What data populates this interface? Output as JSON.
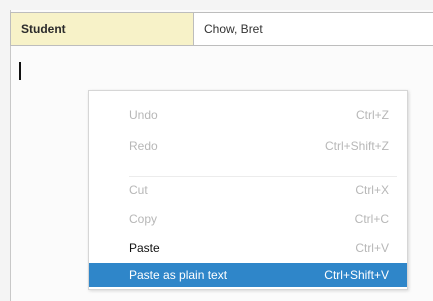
{
  "header": {
    "label": "Student",
    "value": "Chow, Bret"
  },
  "context_menu": {
    "items": [
      {
        "label": "Undo",
        "shortcut": "Ctrl+Z",
        "state": "disabled"
      },
      {
        "label": "Redo",
        "shortcut": "Ctrl+Shift+Z",
        "state": "disabled"
      },
      {
        "label": "Cut",
        "shortcut": "Ctrl+X",
        "state": "disabled"
      },
      {
        "label": "Copy",
        "shortcut": "Ctrl+C",
        "state": "disabled"
      },
      {
        "label": "Paste",
        "shortcut": "Ctrl+V",
        "state": "enabled"
      },
      {
        "label": "Paste as plain text",
        "shortcut": "Ctrl+Shift+V",
        "state": "highlighted"
      }
    ]
  },
  "colors": {
    "highlight": "#2f86c9",
    "header_label_bg": "#f7f2c8"
  }
}
